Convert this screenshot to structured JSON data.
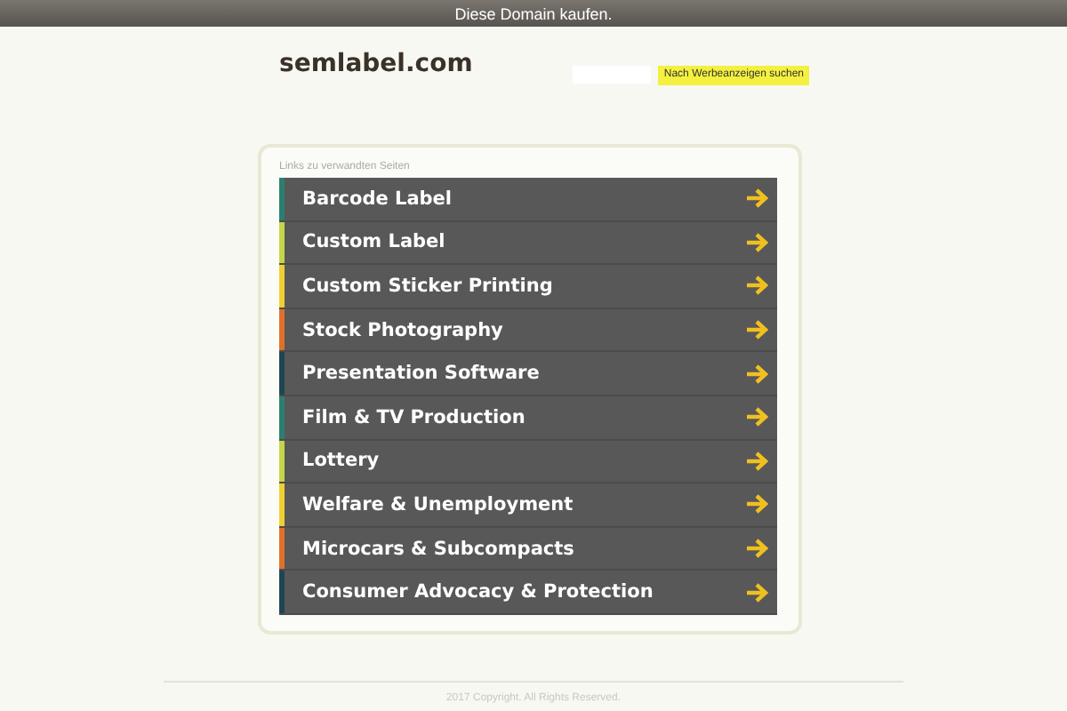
{
  "top_bar": {
    "text": "Diese Domain kaufen."
  },
  "header": {
    "domain": "semlabel.com",
    "search_button": "Nach Werbeanzeigen suchen"
  },
  "links_panel": {
    "heading": "Links zu verwandten Seiten",
    "items": [
      {
        "label": "Barcode Label",
        "color": "#2a8070"
      },
      {
        "label": "Custom Label",
        "color": "#c5d64a"
      },
      {
        "label": "Custom Sticker Printing",
        "color": "#f0d030"
      },
      {
        "label": "Stock Photography",
        "color": "#e0702a"
      },
      {
        "label": "Presentation Software",
        "color": "#1e4652"
      },
      {
        "label": "Film & TV Production",
        "color": "#2a8070"
      },
      {
        "label": "Lottery",
        "color": "#c5d64a"
      },
      {
        "label": "Welfare & Unemployment",
        "color": "#f0d030"
      },
      {
        "label": "Microcars & Subcompacts",
        "color": "#e0702a"
      },
      {
        "label": "Consumer Advocacy & Protection",
        "color": "#1e4652"
      }
    ]
  },
  "footer": {
    "text": "2017 Copyright. All Rights Reserved."
  }
}
